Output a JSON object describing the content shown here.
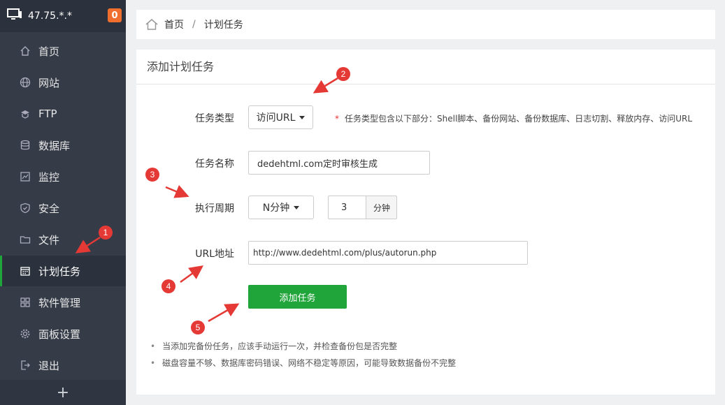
{
  "server": {
    "ip": "47.75.*.*",
    "badge": "0"
  },
  "sidebar": {
    "items": [
      {
        "label": "首页",
        "icon": "home-icon"
      },
      {
        "label": "网站",
        "icon": "globe-icon"
      },
      {
        "label": "FTP",
        "icon": "ftp-icon"
      },
      {
        "label": "数据库",
        "icon": "database-icon"
      },
      {
        "label": "监控",
        "icon": "monitor-chart-icon"
      },
      {
        "label": "安全",
        "icon": "shield-icon"
      },
      {
        "label": "文件",
        "icon": "folder-icon"
      },
      {
        "label": "计划任务",
        "icon": "calendar-icon"
      },
      {
        "label": "软件管理",
        "icon": "grid-icon"
      },
      {
        "label": "面板设置",
        "icon": "gear-icon"
      },
      {
        "label": "退出",
        "icon": "logout-icon"
      }
    ],
    "footer": "+"
  },
  "breadcrumb": {
    "home": "首页",
    "separator": "/",
    "current": "计划任务"
  },
  "panel": {
    "title": "添加计划任务",
    "task_type": {
      "label": "任务类型",
      "value": "访问URL",
      "hint": "任务类型包含以下部分：Shell脚本、备份网站、备份数据库、日志切割、释放内存、访问URL",
      "star": "*"
    },
    "task_name": {
      "label": "任务名称",
      "value": "dedehtml.com定时审核生成"
    },
    "period": {
      "label": "执行周期",
      "type": "N分钟",
      "value": "3",
      "unit": "分钟"
    },
    "url": {
      "label": "URL地址",
      "value": "http://www.dedehtml.com/plus/autorun.php"
    },
    "submit": "添加任务",
    "tips": [
      "当添加完备份任务，应该手动运行一次，并检查备份包是否完整",
      "磁盘容量不够、数据库密码错误、网络不稳定等原因，可能导致数据备份不完整"
    ]
  },
  "annotations": [
    "1",
    "2",
    "3",
    "4",
    "5"
  ],
  "colors": {
    "sidebar_bg": "#353c48",
    "accent_green": "#20a53a",
    "annotation_red": "#e53935",
    "badge_orange": "#f06f2e"
  }
}
